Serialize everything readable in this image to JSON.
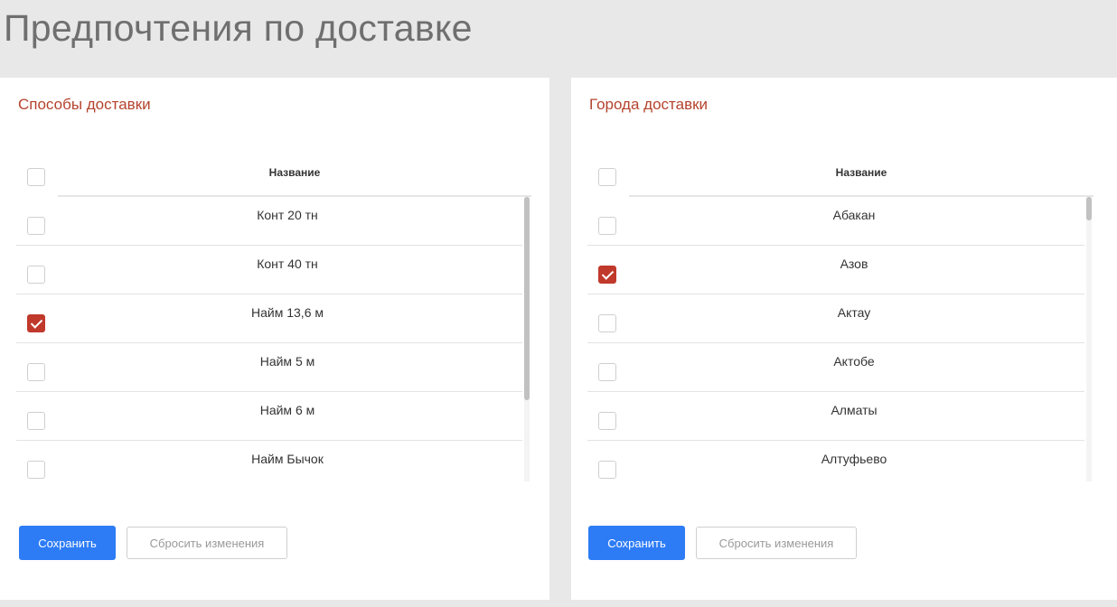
{
  "page": {
    "title": "Предпочтения по доставке"
  },
  "colors": {
    "accent_red": "#b5432d",
    "checkbox_checked": "#c0392b",
    "primary_button": "#2d7cf6",
    "background": "#e8e8e8"
  },
  "delivery_methods": {
    "title": "Способы доставки",
    "column_header": "Название",
    "header_checked": false,
    "scroll_position": 0.0,
    "rows": [
      {
        "name": "Конт 20 тн",
        "checked": false
      },
      {
        "name": "Конт 40 тн",
        "checked": false
      },
      {
        "name": "Найм 13,6 м",
        "checked": true
      },
      {
        "name": "Найм 5 м",
        "checked": false
      },
      {
        "name": "Найм 6 м",
        "checked": false
      },
      {
        "name": "Найм Бычок",
        "checked": false
      }
    ],
    "save_label": "Сохранить",
    "reset_label": "Сбросить изменения"
  },
  "delivery_cities": {
    "title": "Города доставки",
    "column_header": "Название",
    "header_checked": false,
    "scroll_position": 0.0,
    "rows": [
      {
        "name": "Абакан",
        "checked": false
      },
      {
        "name": "Азов",
        "checked": true
      },
      {
        "name": "Актау",
        "checked": false
      },
      {
        "name": "Актобе",
        "checked": false
      },
      {
        "name": "Алматы",
        "checked": false
      },
      {
        "name": "Алтуфьево",
        "checked": false
      }
    ],
    "save_label": "Сохранить",
    "reset_label": "Сбросить изменения"
  }
}
